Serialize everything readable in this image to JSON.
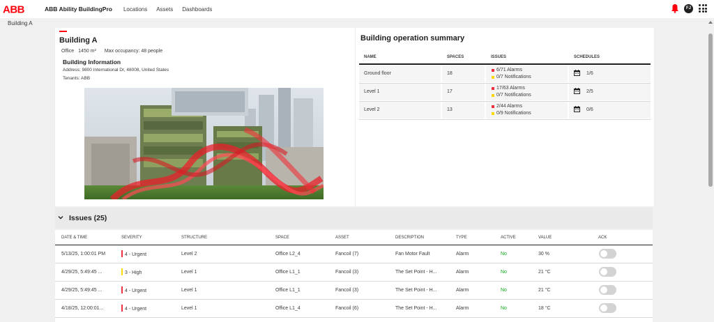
{
  "header": {
    "logo_text": "ABB",
    "app_title": "ABB Ability BuildingPro",
    "nav": [
      "Locations",
      "Assets",
      "Dashboards"
    ],
    "user_initials": "FJ"
  },
  "breadcrumb": "Building A",
  "building": {
    "name": "Building A",
    "type": "Office",
    "area": "1450 m²",
    "occupancy": "Max occupancy: 48 people",
    "info_title": "Building Information",
    "address": "Address: 9800 International Dr, 48008, United States",
    "tenants": "Tenants: ABB"
  },
  "summary": {
    "title": "Building operation summary",
    "columns": [
      "NAME",
      "SPACES",
      "ISSUES",
      "SCHEDULES"
    ],
    "rows": [
      {
        "name": "Ground floor",
        "spaces": "18",
        "alarms": "6/71 Alarms",
        "notifications": "0/7 Notifications",
        "schedules": "1/6"
      },
      {
        "name": "Level 1",
        "spaces": "17",
        "alarms": "17/63 Alarms",
        "notifications": "0/7 Notifications",
        "schedules": "2/5"
      },
      {
        "name": "Level 2",
        "spaces": "13",
        "alarms": "2/44 Alarms",
        "notifications": "0/9 Notifications",
        "schedules": "0/6"
      }
    ]
  },
  "issues": {
    "title": "Issues (25)",
    "columns": [
      "DATE & TIME",
      "SEVERITY",
      "STRUCTURE",
      "SPACE",
      "ASSET",
      "DESCRIPTION",
      "TYPE",
      "ACTIVE",
      "VALUE",
      "ACK"
    ],
    "rows": [
      {
        "date": "5/13/25, 1:00:01 PM",
        "severity": "4 - Urgent",
        "structure": "Level 2",
        "space": "Office L2_4",
        "asset": "Fancoil (7)",
        "description": "Fan Motor Fault",
        "type": "Alarm",
        "active": "No",
        "value": "30 %"
      },
      {
        "date": "4/29/25, 5:49:45 ...",
        "severity": "3 - High",
        "structure": "Level 1",
        "space": "Office L1_1",
        "asset": "Fancoil (3)",
        "description": "The Set Point - H...",
        "type": "Alarm",
        "active": "No",
        "value": "21 °C"
      },
      {
        "date": "4/29/25, 5:49:45 ...",
        "severity": "4 - Urgent",
        "structure": "Level 1",
        "space": "Office L1_1",
        "asset": "Fancoil (3)",
        "description": "The Set Point - H...",
        "type": "Alarm",
        "active": "No",
        "value": "21 °C"
      },
      {
        "date": "4/18/25, 12:00:01...",
        "severity": "4 - Urgent",
        "structure": "Level 1",
        "space": "Office L1_4",
        "asset": "Fancoil (6)",
        "description": "The Set Point - H...",
        "type": "Alarm",
        "active": "No",
        "value": "18 °C"
      }
    ]
  },
  "colors": {
    "brand_red": "#ff000f",
    "urgent": "#f03040",
    "high": "#ffd800",
    "alarm": "#f03040",
    "notification": "#ffd800",
    "active_no": "#0ca919"
  }
}
